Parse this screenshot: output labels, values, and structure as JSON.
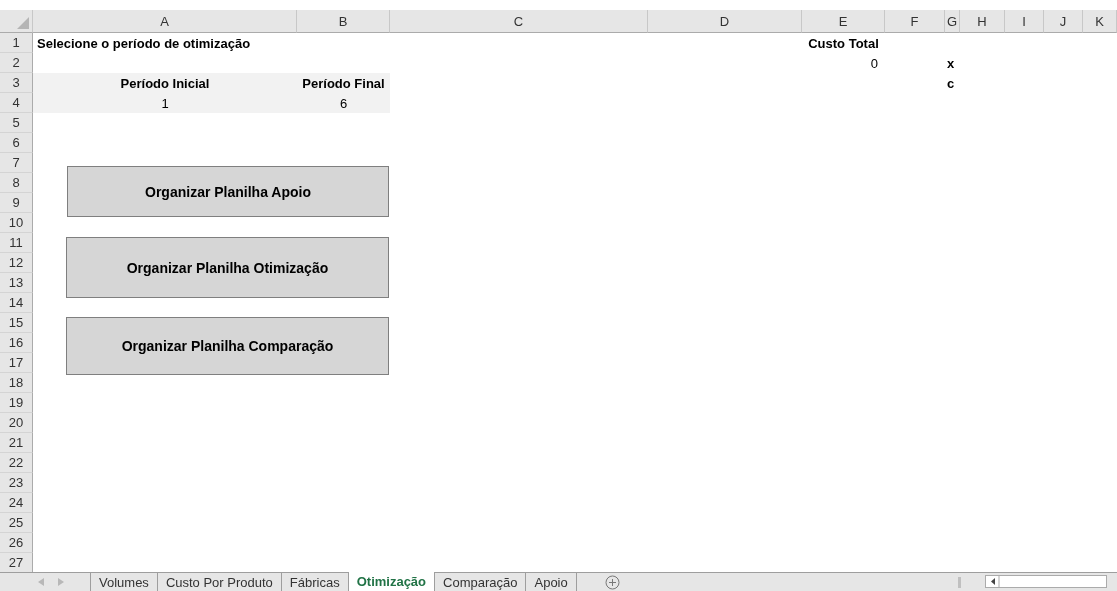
{
  "column_headers": [
    "A",
    "B",
    "C",
    "D",
    "E",
    "F",
    "G",
    "H",
    "I",
    "J",
    "K"
  ],
  "row_numbers": [
    "1",
    "2",
    "3",
    "4",
    "5",
    "6",
    "7",
    "8",
    "9",
    "10",
    "11",
    "12",
    "13",
    "14",
    "15",
    "16",
    "17",
    "18",
    "19",
    "20",
    "21",
    "22",
    "23",
    "24",
    "25",
    "26",
    "27"
  ],
  "title": "Selecione o período de otimização",
  "period_table": {
    "headers": [
      "Período Inicial",
      "Período Final"
    ],
    "values": [
      "1",
      "6"
    ]
  },
  "total_cost": {
    "label": "Custo Total",
    "value": "0"
  },
  "markers": [
    "x",
    "c"
  ],
  "buttons": [
    "Organizar Planilha Apoio",
    "Organizar Planilha Otimização",
    "Organizar Planilha Comparação"
  ],
  "sheet_tabs": [
    {
      "label": "Volumes",
      "selected": false
    },
    {
      "label": "Custo Por Produto",
      "selected": false
    },
    {
      "label": "Fábricas",
      "selected": false
    },
    {
      "label": "Otimização",
      "selected": true
    },
    {
      "label": "Comparação",
      "selected": false
    },
    {
      "label": "Apoio",
      "selected": false
    }
  ]
}
